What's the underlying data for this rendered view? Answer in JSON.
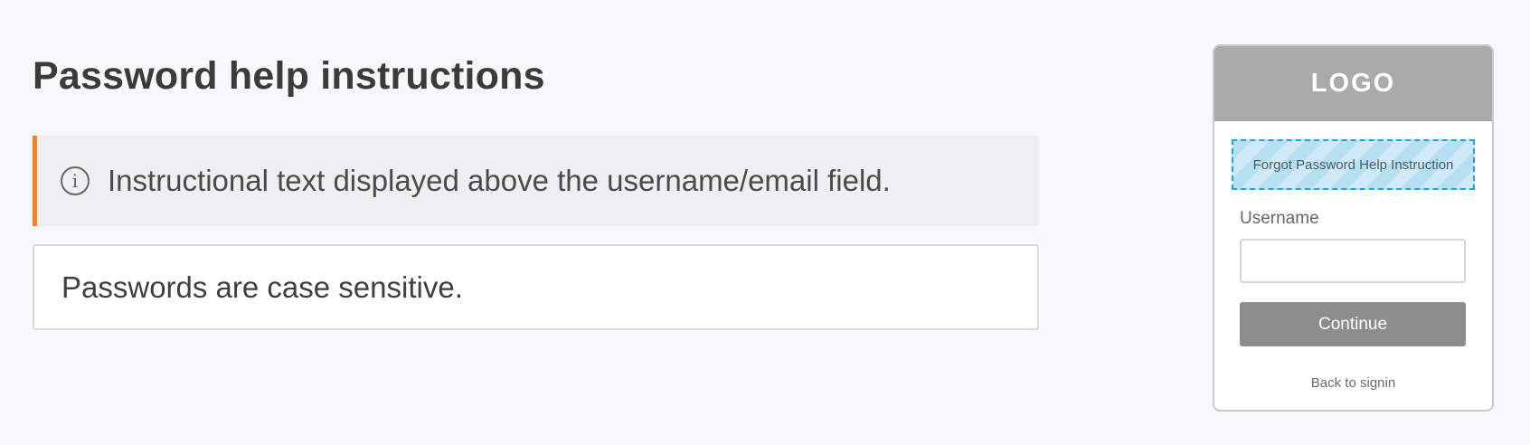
{
  "main": {
    "title": "Password help instructions",
    "info": {
      "icon": "info-circle-icon",
      "icon_glyph": "i",
      "text": "Instructional text displayed above the username/email field.",
      "accent_color": "#f5821f"
    },
    "value_text": "Passwords are case sensitive."
  },
  "preview": {
    "logo": "LOGO",
    "highlight_label": "Forgot Password Help Instruction",
    "username_label": "Username",
    "username_value": "",
    "continue_label": "Continue",
    "back_link": "Back to signin"
  }
}
